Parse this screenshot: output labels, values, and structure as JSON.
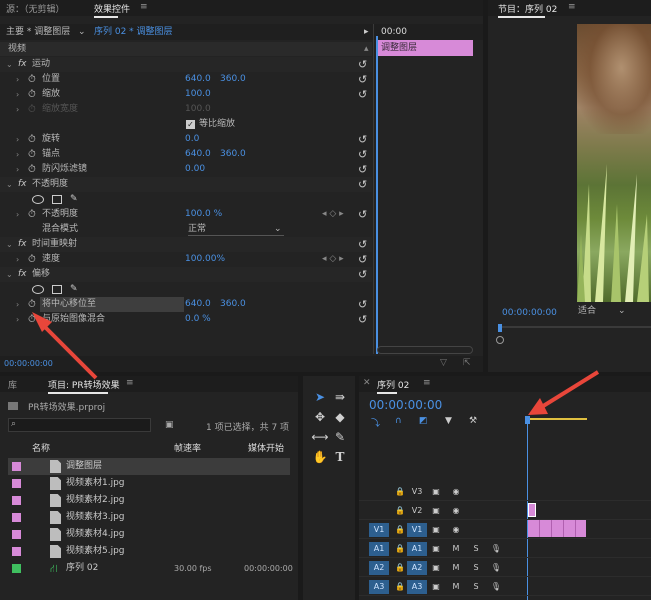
{
  "effect_controls": {
    "tab_source": "源：（无剪辑）",
    "tab_effect_controls": "效果控件",
    "menu_icon": "≡",
    "crumb_main": "主要 * 调整图层",
    "crumb_seq": "序列 02 * 调整图层",
    "timecode_start": "00:00",
    "clip_bar_label": "调整图层",
    "section_video": "视频",
    "bottom_timecode": "00:00:00:00",
    "rows": [
      {
        "type": "fx",
        "label": "运动"
      },
      {
        "type": "prop",
        "label": "位置",
        "v1": "640.0",
        "v2": "360.0"
      },
      {
        "type": "prop",
        "label": "缩放",
        "v1": "100.0",
        "v2": ""
      },
      {
        "type": "prop-dim",
        "label": "缩放宽度",
        "v1": "100.0",
        "v2": ""
      },
      {
        "type": "check",
        "label": "等比缩放"
      },
      {
        "type": "prop",
        "label": "旋转",
        "v1": "0.0",
        "v2": ""
      },
      {
        "type": "prop",
        "label": "锚点",
        "v1": "640.0",
        "v2": "360.0"
      },
      {
        "type": "prop",
        "label": "防闪烁滤镜",
        "v1": "0.00",
        "v2": ""
      },
      {
        "type": "fx",
        "label": "不透明度"
      },
      {
        "type": "shapes"
      },
      {
        "type": "prop-kf",
        "label": "不透明度",
        "v1": "100.0 %",
        "v2": ""
      },
      {
        "type": "select",
        "label": "混合模式",
        "v1": "正常"
      },
      {
        "type": "fx",
        "label": "时间重映射"
      },
      {
        "type": "prop-kf",
        "label": "速度",
        "v1": "100.00%",
        "v2": ""
      },
      {
        "type": "fx",
        "label": "偏移"
      },
      {
        "type": "shapes"
      },
      {
        "type": "prop-hl",
        "label": "将中心移位至",
        "v1": "640.0",
        "v2": "360.0"
      },
      {
        "type": "prop",
        "label": "与原始图像混合",
        "v1": "0.0 %",
        "v2": ""
      }
    ]
  },
  "program": {
    "title": "节目：序列 02",
    "menu_icon": "≡",
    "timecode": "00:00:00:00",
    "fit": "适合"
  },
  "project": {
    "tab_lib": "库",
    "tab_project": "项目: PR转场效果",
    "menu_icon": "≡",
    "file": "PR转场效果.prproj",
    "search_placeholder": "",
    "selection_info": "1 项已选择，共 7 项",
    "col_name": "名称",
    "col_fps": "帧速率",
    "col_start": "媒体开始",
    "items": [
      {
        "name": "调整图层",
        "fps": "",
        "start": "",
        "color": "#d78ad8",
        "selected": true
      },
      {
        "name": "视频素材1.jpg",
        "fps": "",
        "start": "",
        "color": "#d78ad8",
        "selected": false
      },
      {
        "name": "视频素材2.jpg",
        "fps": "",
        "start": "",
        "color": "#d78ad8",
        "selected": false
      },
      {
        "name": "视频素材3.jpg",
        "fps": "",
        "start": "",
        "color": "#d78ad8",
        "selected": false
      },
      {
        "name": "视频素材4.jpg",
        "fps": "",
        "start": "",
        "color": "#d78ad8",
        "selected": false
      },
      {
        "name": "视频素材5.jpg",
        "fps": "",
        "start": "",
        "color": "#d78ad8",
        "selected": false
      },
      {
        "name": "序列 02",
        "fps": "30.00 fps",
        "start": "00:00:00:00",
        "color": "#3fbf5f",
        "selected": false
      }
    ]
  },
  "timeline": {
    "tab": "序列 02",
    "menu_icon": "≡",
    "timecode": "00:00:00:00",
    "tracks": [
      {
        "name": "V3",
        "src": "",
        "kind": "video"
      },
      {
        "name": "V2",
        "src": "",
        "kind": "video"
      },
      {
        "name": "V1",
        "src": "V1",
        "kind": "video"
      },
      {
        "name": "A1",
        "src": "A1",
        "kind": "audio"
      },
      {
        "name": "A2",
        "src": "A2",
        "kind": "audio"
      },
      {
        "name": "A3",
        "src": "A3",
        "kind": "audio"
      }
    ],
    "track_controls": {
      "lock": "🔒",
      "sync": "▣",
      "eye": "👁",
      "mute": "M",
      "solo": "S",
      "mic": "🎙"
    }
  },
  "colors": {
    "accent": "#4a90e2",
    "clip": "#d78ad8",
    "arrow": "#e8463a"
  }
}
